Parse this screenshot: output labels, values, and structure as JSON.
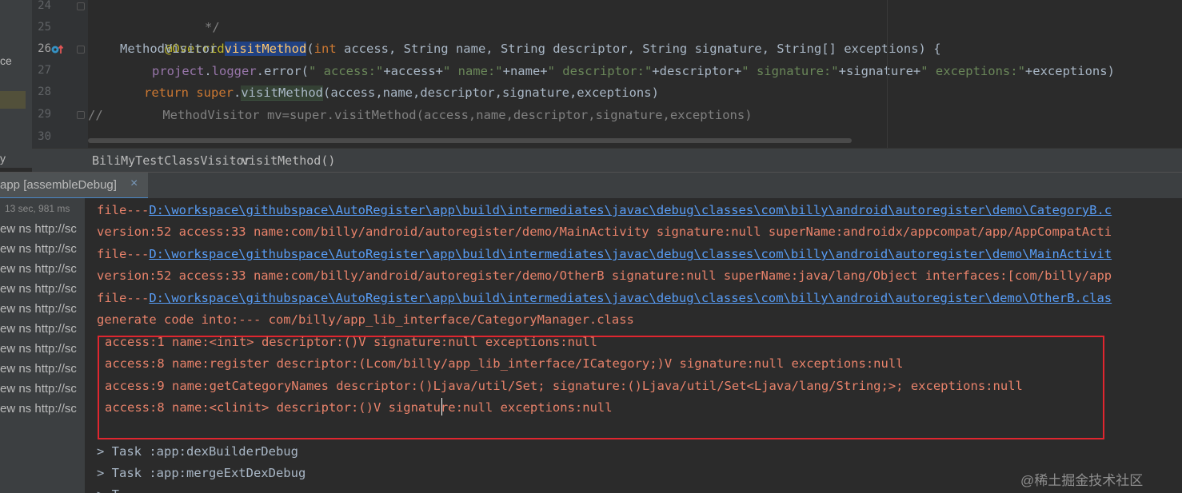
{
  "left_strip": {
    "frag1": "ce",
    "frag2": "y"
  },
  "editor": {
    "gutter_lines": [
      "24",
      "25",
      "26",
      "27",
      "28",
      "29",
      "30"
    ],
    "code": {
      "l24_comment": "*/",
      "l25_annotation": "@Override",
      "l26_type": "MethodVisitor ",
      "l26_method": "visitMethod",
      "l26_open": "(",
      "l26_int": "int",
      "l26_rest": " access, String name, String descriptor, String signature, String[] exceptions) {",
      "l27_project": "project",
      "l27_dot1": ".",
      "l27_logger": "logger",
      "l27_error": ".error(",
      "l27_s1": "\" access:\"",
      "l27_p1": "+access+",
      "l27_s2": "\" name:\"",
      "l27_p2": "+name+",
      "l27_s3": "\" descriptor:\"",
      "l27_p3": "+descriptor+",
      "l27_s4": "\" signature:\"",
      "l27_p4": "+signature+",
      "l27_s5": "\" exceptions:\"",
      "l27_p5": "+exceptions)",
      "l28_return": "return ",
      "l28_super": "super",
      "l28_dot": ".",
      "l28_method": "visitMethod",
      "l28_args": "(access,name,descriptor,signature,exceptions)",
      "l29_slashes": "//",
      "l29_comment": "        MethodVisitor mv=super.visitMethod(access,name,descriptor,signature,exceptions)"
    }
  },
  "breadcrumb": {
    "class_name": "BiliMyTestClassVisitor",
    "separator": "›",
    "method_name": "visitMethod()"
  },
  "run_tab": {
    "label": "app [assembleDebug]",
    "close": "×"
  },
  "build_tree": {
    "time": "13 sec, 981 ms",
    "rows": [
      "ew ns http://sc",
      "ew ns http://sc",
      "ew ns http://sc",
      "ew ns http://sc",
      "ew ns http://sc",
      "ew ns http://sc",
      "ew ns http://sc",
      "ew ns http://sc",
      "ew ns http://sc",
      "ew ns http://sc"
    ]
  },
  "console": {
    "lines": [
      {
        "prefix": "file---",
        "link": "D:\\workspace\\githubspace\\AutoRegister\\app\\build\\intermediates\\javac\\debug\\classes\\com\\billy\\android\\autoregister\\demo\\CategoryB.c"
      },
      {
        "text": "version:52 access:33 name:com/billy/android/autoregister/demo/MainActivity signature:null superName:androidx/appcompat/app/AppCompatActi"
      },
      {
        "prefix": "file---",
        "link": "D:\\workspace\\githubspace\\AutoRegister\\app\\build\\intermediates\\javac\\debug\\classes\\com\\billy\\android\\autoregister\\demo\\MainActivit"
      },
      {
        "text": "version:52 access:33 name:com/billy/android/autoregister/demo/OtherB signature:null superName:java/lang/Object interfaces:[com/billy/app"
      },
      {
        "prefix": "file---",
        "link": "D:\\workspace\\githubspace\\AutoRegister\\app\\build\\intermediates\\javac\\debug\\classes\\com\\billy\\android\\autoregister\\demo\\OtherB.clas"
      },
      {
        "text": "generate code into:--- com/billy/app_lib_interface/CategoryManager.class"
      }
    ],
    "boxed_lines": [
      "access:1 name:<init> descriptor:()V signature:null exceptions:null",
      "access:8 name:register descriptor:(Lcom/billy/app_lib_interface/ICategory;)V signature:null exceptions:null",
      "access:9 name:getCategoryNames descriptor:()Ljava/util/Set; signature:()Ljava/util/Set<Ljava/lang/String;>; exceptions:null",
      "access:8 name:<clinit> descriptor:()V signature:null exceptions:null"
    ],
    "tasks": [
      "> Task :app:dexBuilderDebug",
      "> Task :app:mergeExtDexDebug"
    ],
    "highlight_color": "#e0262f"
  },
  "watermark": "@稀土掘金技术社区",
  "colors": {
    "keyword": "#cc7832",
    "annotation": "#bbb529",
    "string": "#6a8759",
    "field": "#9876aa",
    "method": "#ffc66d",
    "error_text": "#e8826a",
    "link": "#589df6"
  }
}
